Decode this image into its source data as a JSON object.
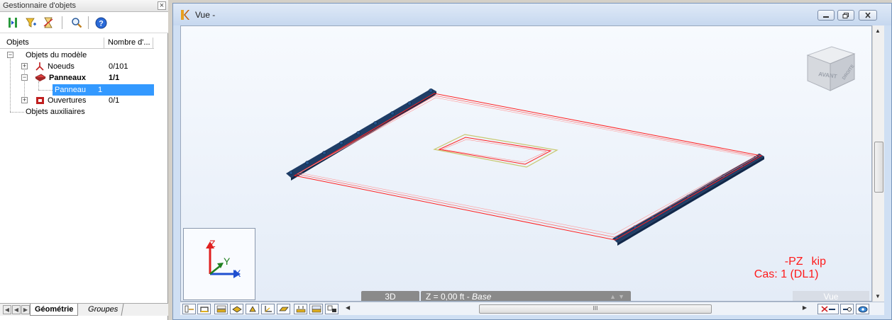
{
  "object_manager": {
    "title": "Gestionnaire d'objets",
    "close_label": "×",
    "toolbar_icons": [
      "select-columns-icon",
      "filter-icon",
      "hourglass-filter-icon",
      "search-icon",
      "help-icon"
    ],
    "columns": {
      "objets": "Objets",
      "nombre": "Nombre d'..."
    },
    "tree": {
      "model_objects": "Objets du modèle",
      "noeuds": {
        "label": "Noeuds",
        "count": "0/101"
      },
      "panneaux": {
        "label": "Panneaux",
        "count": "1/1"
      },
      "panneau_child": {
        "label": "Panneau",
        "count": "1"
      },
      "ouvertures": {
        "label": "Ouvertures",
        "count": "0/1"
      },
      "aux_objects": "Objets auxiliaires"
    },
    "tabs": {
      "geometrie": "Géométrie",
      "groupes": "Groupes"
    }
  },
  "view": {
    "title": "Vue -",
    "nav_cube": {
      "front": "AVANT",
      "right": "DROITE"
    },
    "axes": {
      "x": "X",
      "y": "Y",
      "z": "Z"
    },
    "result": {
      "component": "-PZ",
      "unit": "kip",
      "case": "Cas: 1 (DL1)"
    },
    "status": {
      "mode": "3D",
      "plane_prefix": "Z = 0,00 ft - ",
      "plane_name": "Base",
      "vue_button": "Vue"
    },
    "scroll_grip": "III",
    "colors": {
      "panel_edge": "#ff2020",
      "support": "#1f3d66",
      "opening_outline": "#c8c870",
      "axis_z": "#e02020",
      "axis_y": "#208020",
      "axis_x": "#1f4fd0"
    }
  }
}
